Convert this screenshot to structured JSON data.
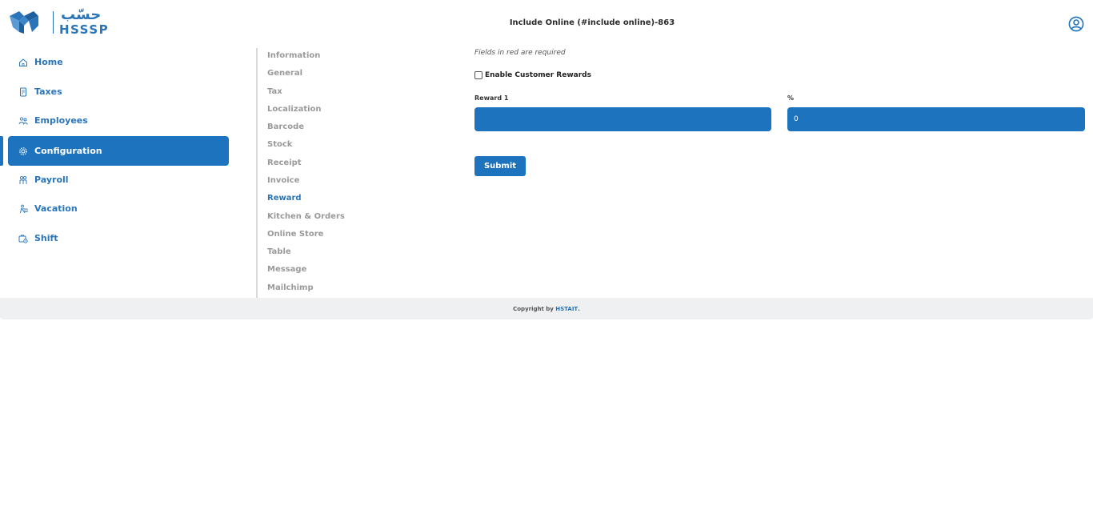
{
  "header": {
    "logo_ar": "حسّب",
    "logo_en": "HSSSP",
    "title": "Include Online (#include online)-863"
  },
  "sidebar": {
    "items": [
      {
        "label": "Home",
        "icon": "home-icon"
      },
      {
        "label": "Taxes",
        "icon": "receipt-icon"
      },
      {
        "label": "Employees",
        "icon": "users-icon"
      },
      {
        "label": "Configuration",
        "icon": "gear-icon",
        "active": true
      },
      {
        "label": "Payroll",
        "icon": "payroll-icon"
      },
      {
        "label": "Vacation",
        "icon": "vacation-icon"
      },
      {
        "label": "Shift",
        "icon": "shift-icon"
      }
    ]
  },
  "subnav": {
    "items": [
      "Information",
      "General",
      "Tax",
      "Localization",
      "Barcode",
      "Stock",
      "Receipt",
      "Invoice",
      "Reward",
      "Kitchen & Orders",
      "Online Store",
      "Table",
      "Message",
      "Mailchimp"
    ],
    "active": "Reward"
  },
  "form": {
    "required_note": "Fields in red are required",
    "enable_rewards_label": "Enable Customer Rewards",
    "enable_rewards_checked": false,
    "reward_label": "Reward 1",
    "reward_value": "",
    "percent_label": "%",
    "percent_value": "0",
    "submit_label": "Submit"
  },
  "footer": {
    "prefix": "Copyright by ",
    "brand": "HSTAIT",
    "suffix": "."
  },
  "colors": {
    "primary": "#1e73be",
    "text_link": "#2a74b9",
    "muted": "#9a9a9a",
    "footer_bg": "#eef0f1"
  }
}
